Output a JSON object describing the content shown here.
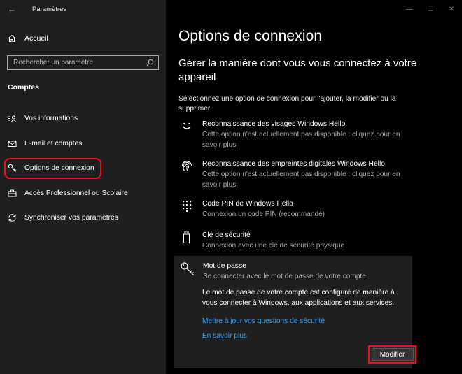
{
  "window": {
    "title": "Paramètres",
    "controls": [
      "—",
      "☐",
      "✕"
    ]
  },
  "sidebar": {
    "home_label": "Accueil",
    "search": {
      "placeholder": "Rechercher un paramètre"
    },
    "section_title": "Comptes",
    "items": [
      {
        "label": "Vos informations",
        "icon": "person-card-icon"
      },
      {
        "label": "E-mail et comptes",
        "icon": "mail-icon"
      },
      {
        "label": "Options de connexion",
        "icon": "key-icon",
        "selected": true
      },
      {
        "label": "Accès Professionnel ou Scolaire",
        "icon": "briefcase-icon"
      },
      {
        "label": "Synchroniser vos paramètres",
        "icon": "sync-icon"
      }
    ]
  },
  "main": {
    "title": "Options de connexion",
    "subtitle": "Gérer la manière dont vous vous connectez à votre appareil",
    "intro": "Sélectionnez une option de connexion pour l'ajouter, la modifier ou la supprimer.",
    "options": [
      {
        "title": "Reconnaissance des visages Windows Hello",
        "desc": "Cette option n'est actuellement pas disponible : cliquez pour en savoir plus",
        "icon": "face-icon"
      },
      {
        "title": "Reconnaissance des empreintes digitales Windows Hello",
        "desc": "Cette option n'est actuellement pas disponible : cliquez pour en savoir plus",
        "icon": "fingerprint-icon"
      },
      {
        "title": "Code PIN de Windows Hello",
        "desc": "Connexion un code PIN (recommandé)",
        "icon": "keypad-icon"
      },
      {
        "title": "Clé de sécurité",
        "desc": "Connexion avec une clé de sécurité physique",
        "icon": "usb-key-icon"
      }
    ],
    "password": {
      "title": "Mot de passe",
      "desc": "Se connecter avec le mot de passe de votre compte",
      "body": "Le mot de passe de votre compte est configuré de manière à vous connecter à Windows, aux applications et aux services.",
      "link_security": "Mettre à jour vos questions de sécurité",
      "link_learn": "En savoir plus",
      "modify_label": "Modifier"
    }
  },
  "colors": {
    "sidebar_bg": "#1f1f1f",
    "main_bg": "#000000",
    "link": "#3f9cf0",
    "highlight": "#e81123"
  }
}
